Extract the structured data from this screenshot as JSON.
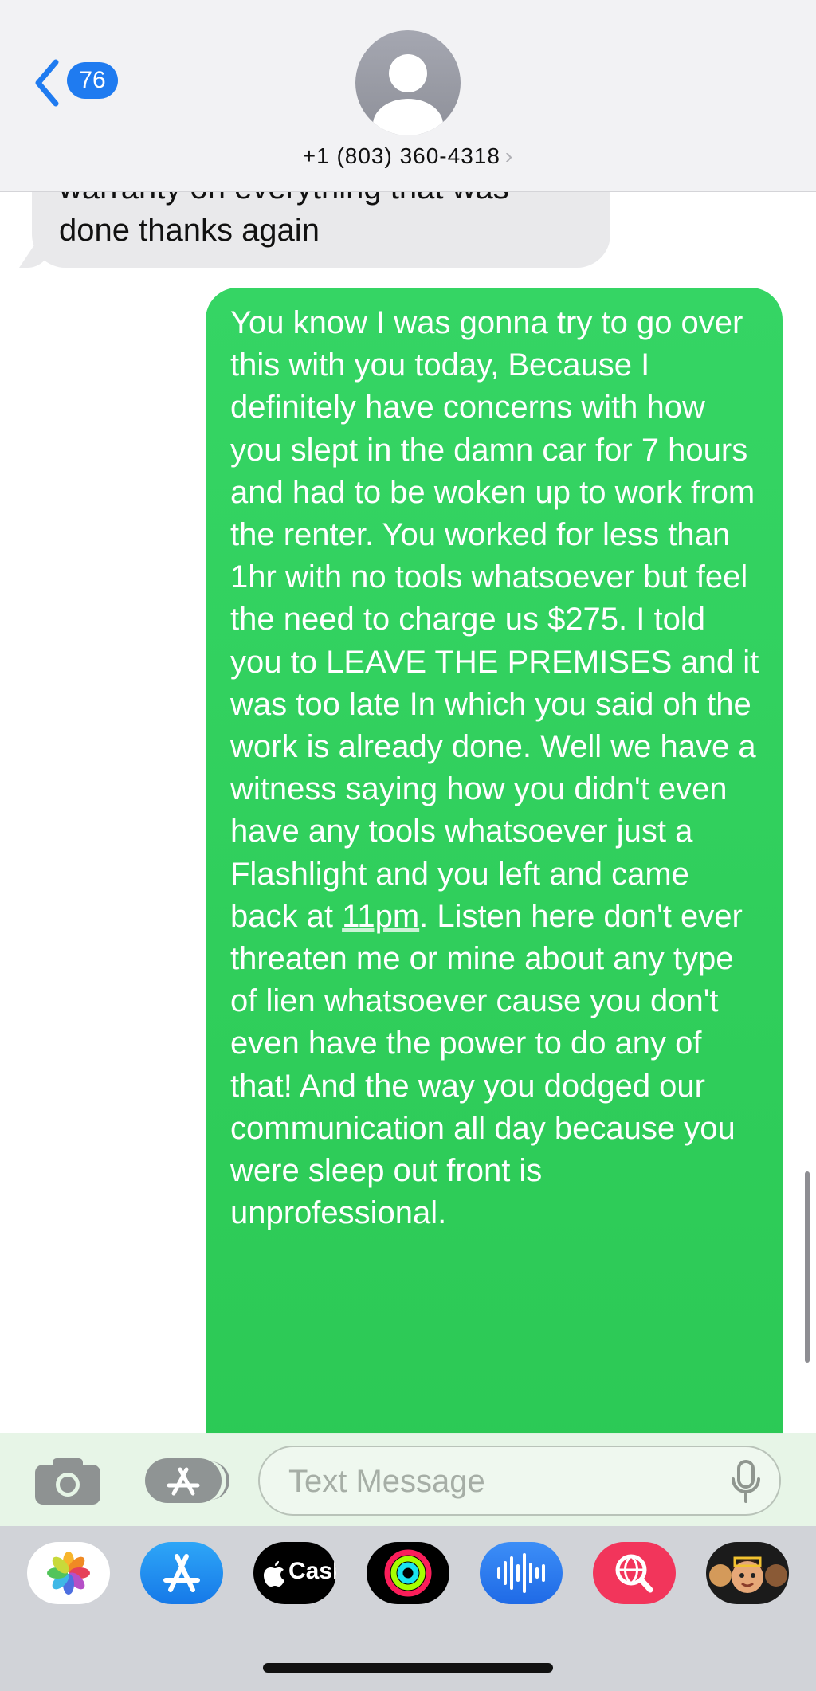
{
  "header": {
    "back_badge_count": "76",
    "contact_name": "+1 (803) 360-4318",
    "contact_chevron": "›"
  },
  "messages": {
    "received_text": "warranty on everything that was done thanks again",
    "sent_text_part1": "You know I was gonna try to go over this with you today, Because I definitely have concerns with how you slept in the damn car for 7 hours and had to be woken up to work from the renter. You worked for less than 1hr with no tools whatsoever but feel the need to charge us $275. I told you to LEAVE THE PREMISES and it was too late In which you said oh the work is already done. Well we have a witness saying how you didn't even have any tools whatsoever just a Flashlight and you left and came back at ",
    "sent_text_link": "11pm",
    "sent_text_part2": ". Listen here don't ever threaten me or mine about any type of lien whatsoever cause you don't even have the power to do any of that! And the way you dodged our communication all day because you were sleep out front is unprofessional."
  },
  "composer": {
    "placeholder": "Text Message",
    "value": ""
  },
  "app_drawer": {
    "apps": [
      {
        "name": "photos-app-icon"
      },
      {
        "name": "app-store-app-icon"
      },
      {
        "name": "apple-cash-app-icon",
        "label": "Cash"
      },
      {
        "name": "activity-app-icon"
      },
      {
        "name": "audio-message-app-icon"
      },
      {
        "name": "images-search-app-icon"
      },
      {
        "name": "memoji-app-icon"
      }
    ]
  },
  "colors": {
    "sent_bubble": "#34d15f",
    "received_bubble": "#e9e9eb",
    "accent_blue": "#1f7bf0",
    "header_bg": "#f2f2f4"
  }
}
